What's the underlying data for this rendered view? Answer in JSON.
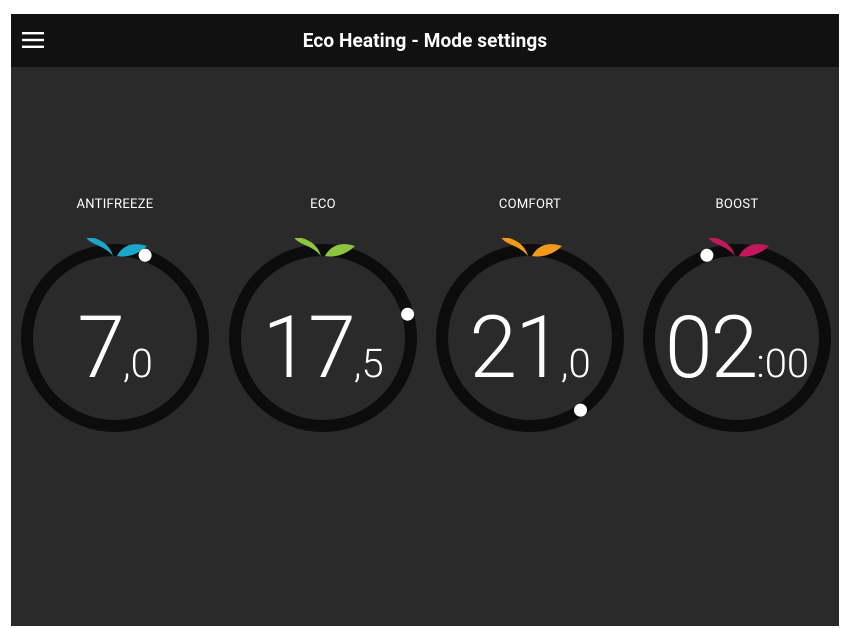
{
  "app": {
    "title": "Eco Heating - Mode settings"
  },
  "icons": {
    "menu": "menu-icon",
    "mode": "leaf-icon"
  },
  "colors": {
    "background": "#2a2a2a",
    "appbar": "#111111",
    "ring_track": "#0c0c0c",
    "knob": "#ffffff"
  },
  "modes": [
    {
      "label": "ANTIFREEZE",
      "major": "7",
      "minor": ",0",
      "color": "#1aa7c9"
    },
    {
      "label": "ECO",
      "major": "17",
      "minor": ",5",
      "color": "#8cc63e"
    },
    {
      "label": "COMFORT",
      "major": "21",
      "minor": ",0",
      "color": "#f39a1a"
    },
    {
      "label": "BOOST",
      "major": "02",
      "minor": ":00",
      "color": "#c2185b"
    }
  ]
}
